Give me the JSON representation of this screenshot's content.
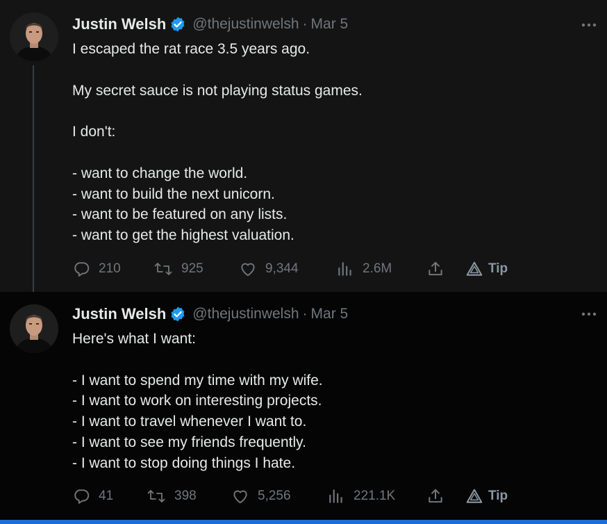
{
  "tweets": [
    {
      "author": "Justin Welsh",
      "handle": "@thejustinwelsh",
      "separator": "·",
      "date": "Mar 5",
      "lines": [
        "I escaped the rat race 3.5 years ago.",
        "",
        "My secret sauce is not playing status games.",
        "",
        "I don't:",
        "",
        "- want to change the world.",
        "- want to build the next unicorn.",
        "- want to be featured on any lists.",
        "- want to get the highest valuation."
      ],
      "replies": "210",
      "retweets": "925",
      "likes": "9,344",
      "views": "2.6M",
      "tip_label": "Tip"
    },
    {
      "author": "Justin Welsh",
      "handle": "@thejustinwelsh",
      "separator": "·",
      "date": "Mar 5",
      "lines": [
        "Here's what I want:",
        "",
        "- I want to spend my time with my wife.",
        "- I want to work on interesting projects.",
        "- I want to travel whenever I want to.",
        "- I want to see my friends frequently.",
        "- I want to stop doing things I hate."
      ],
      "replies": "41",
      "retweets": "398",
      "likes": "5,256",
      "views": "221.1K",
      "tip_label": "Tip"
    }
  ],
  "colors": {
    "text": "#e7e9ea",
    "secondary": "#71767b",
    "verified": "#1d9bf0",
    "accent_bar": "#1d6fd8"
  },
  "icons": [
    "reply-icon",
    "retweet-icon",
    "like-icon",
    "views-icon",
    "share-icon",
    "tip-icon",
    "more-icon",
    "verified-icon"
  ]
}
